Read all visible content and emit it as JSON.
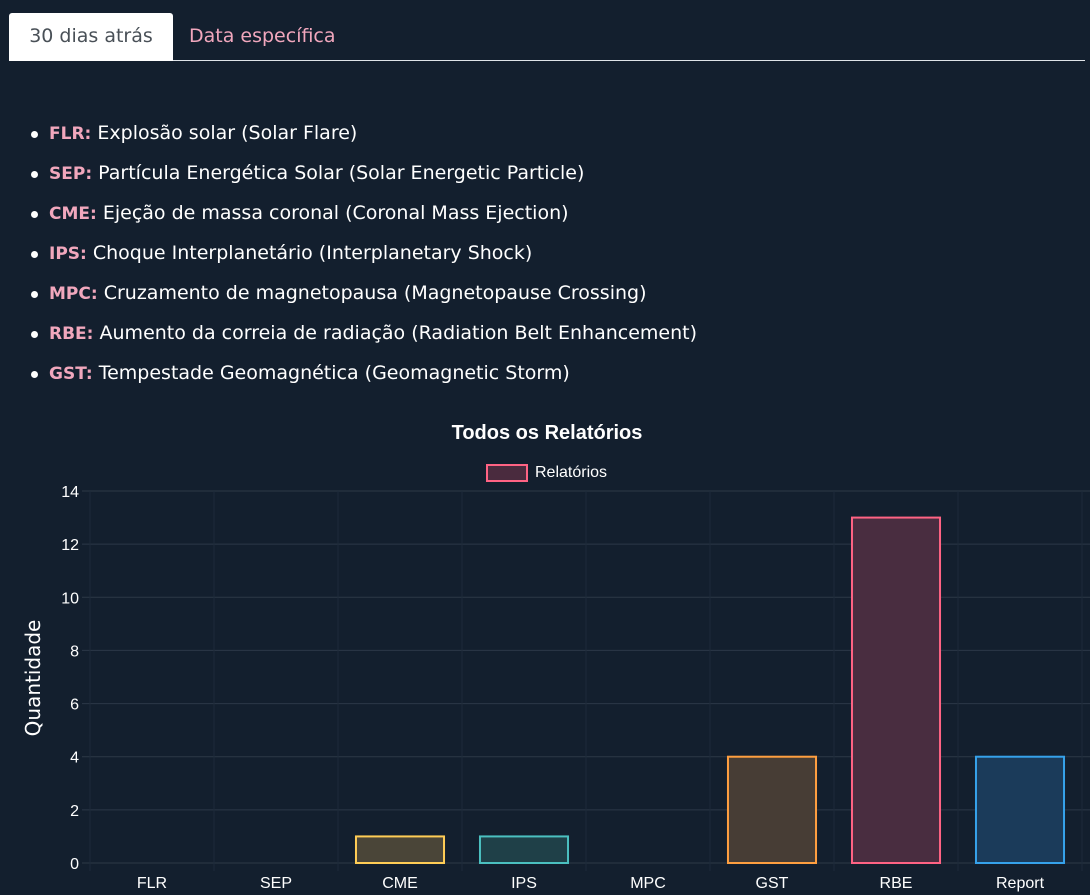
{
  "tabs": [
    {
      "label": "30 dias atrás",
      "active": true
    },
    {
      "label": "Data específica",
      "active": false
    }
  ],
  "event_types": [
    {
      "code": "FLR:",
      "description": "Explosão solar (Solar Flare)"
    },
    {
      "code": "SEP:",
      "description": "Partícula Energética Solar (Solar Energetic Particle)"
    },
    {
      "code": "CME:",
      "description": "Ejeção de massa coronal (Coronal Mass Ejection)"
    },
    {
      "code": "IPS:",
      "description": "Choque Interplanetário (Interplanetary Shock)"
    },
    {
      "code": "MPC:",
      "description": "Cruzamento de magnetopausa (Magnetopause Crossing)"
    },
    {
      "code": "RBE:",
      "description": "Aumento da correia de radiação (Radiation Belt Enhancement)"
    },
    {
      "code": "GST:",
      "description": "Tempestade Geomagnética (Geomagnetic Storm)"
    }
  ],
  "colors": {
    "background": "#131f2e",
    "accent_pink": "#f1a7bd",
    "grid": "#2c3847"
  },
  "chart_data": {
    "type": "bar",
    "title": "Todos os Relatórios",
    "ylabel": "Quantidade",
    "xlabel": "",
    "ylim": [
      0,
      14
    ],
    "yticks": [
      0,
      2,
      4,
      6,
      8,
      10,
      12,
      14
    ],
    "grid": true,
    "legend_position": "top-center",
    "categories": [
      "FLR",
      "SEP",
      "CME",
      "IPS",
      "MPC",
      "GST",
      "RBE",
      "Report"
    ],
    "series": [
      {
        "name": "Relatórios",
        "values": [
          0,
          0,
          1,
          1,
          0,
          4,
          13,
          4
        ],
        "legend_border": "#ff6384",
        "legend_fill": "#4a2b3e",
        "border_colors": [
          "#ff6384",
          "#36a2eb",
          "#ffcd56",
          "#4bc0c0",
          "#9966ff",
          "#ff9f40",
          "#ff6384",
          "#36a2eb"
        ],
        "fill_colors": [
          "#4a2b3e",
          "#1b3b5a",
          "#4a4538",
          "#1f4048",
          "#33304f",
          "#473d35",
          "#492d40",
          "#1b3b5a"
        ]
      }
    ]
  }
}
